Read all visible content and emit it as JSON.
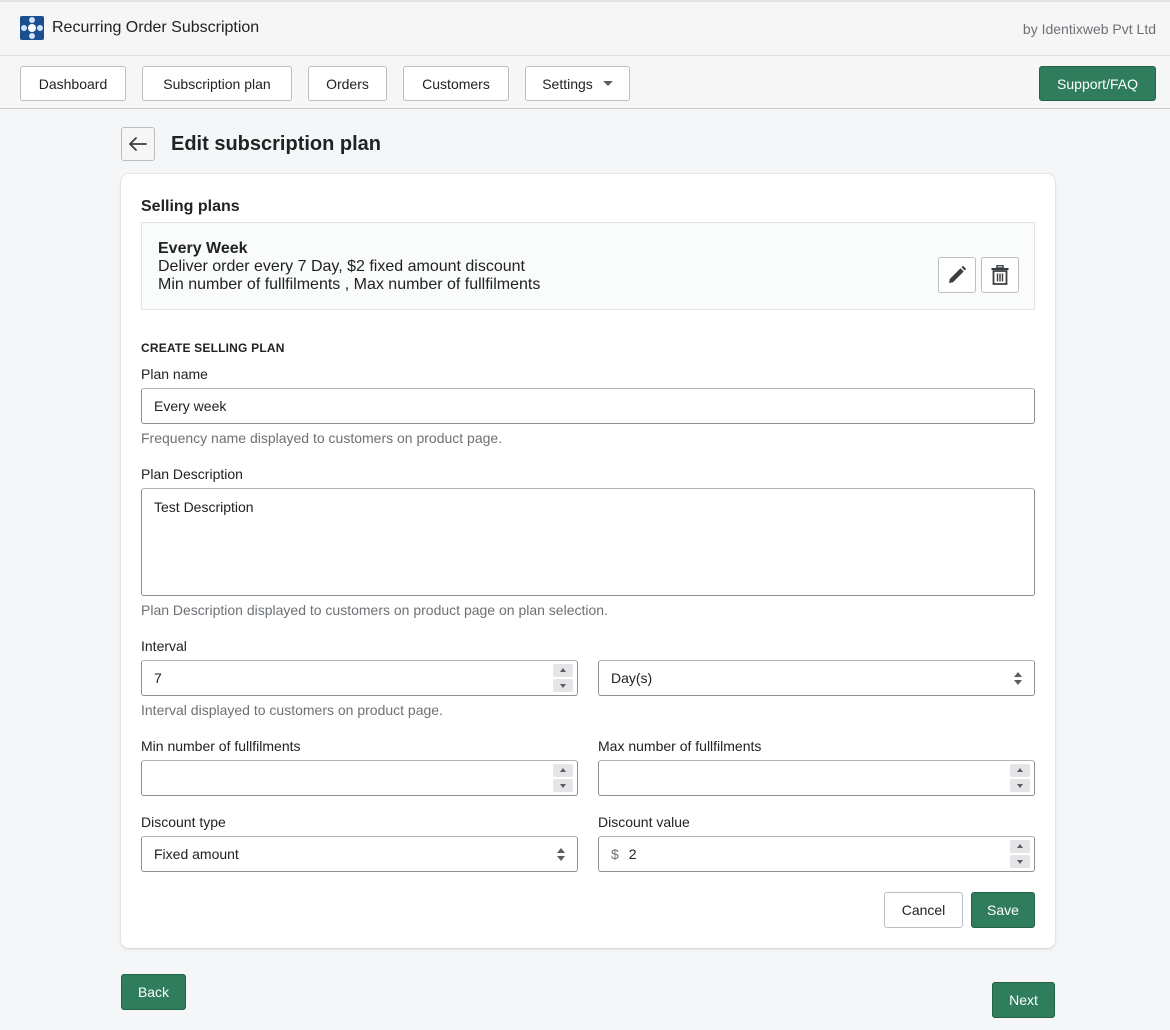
{
  "app": {
    "title": "Recurring Order Subscription",
    "vendor": "by Identixweb Pvt Ltd"
  },
  "nav": {
    "dashboard": "Dashboard",
    "subscription_plan": "Subscription plan",
    "orders": "Orders",
    "customers": "Customers",
    "settings": "Settings",
    "support": "Support/FAQ"
  },
  "page": {
    "title": "Edit subscription plan"
  },
  "selling_plans": {
    "title": "Selling plans",
    "items": [
      {
        "name": "Every Week",
        "line1": "Deliver order every 7 Day, $2 fixed amount discount",
        "line2": "Min number of fullfilments , Max number of fullfilments"
      }
    ]
  },
  "form": {
    "section_title": "CREATE SELLING PLAN",
    "plan_name_label": "Plan name",
    "plan_name_value": "Every week",
    "plan_name_help": "Frequency name displayed to customers on product page.",
    "plan_desc_label": "Plan Description",
    "plan_desc_value": "Test Description",
    "plan_desc_help": "Plan Description displayed to customers on product page on plan selection.",
    "interval_label": "Interval",
    "interval_value": "7",
    "interval_unit": "Day(s)",
    "interval_help": "Interval displayed to customers on product page.",
    "min_label": "Min number of fullfilments",
    "min_value": "",
    "max_label": "Max number of fullfilments",
    "max_value": "",
    "discount_type_label": "Discount type",
    "discount_type_value": "Fixed amount",
    "discount_value_label": "Discount value",
    "discount_prefix": "$",
    "discount_value": "2",
    "cancel": "Cancel",
    "save": "Save"
  },
  "footer": {
    "back": "Back",
    "next": "Next"
  },
  "colors": {
    "primary": "#2f7d5c",
    "background": "#f4f6f8",
    "logo": "#1c4f8f"
  }
}
